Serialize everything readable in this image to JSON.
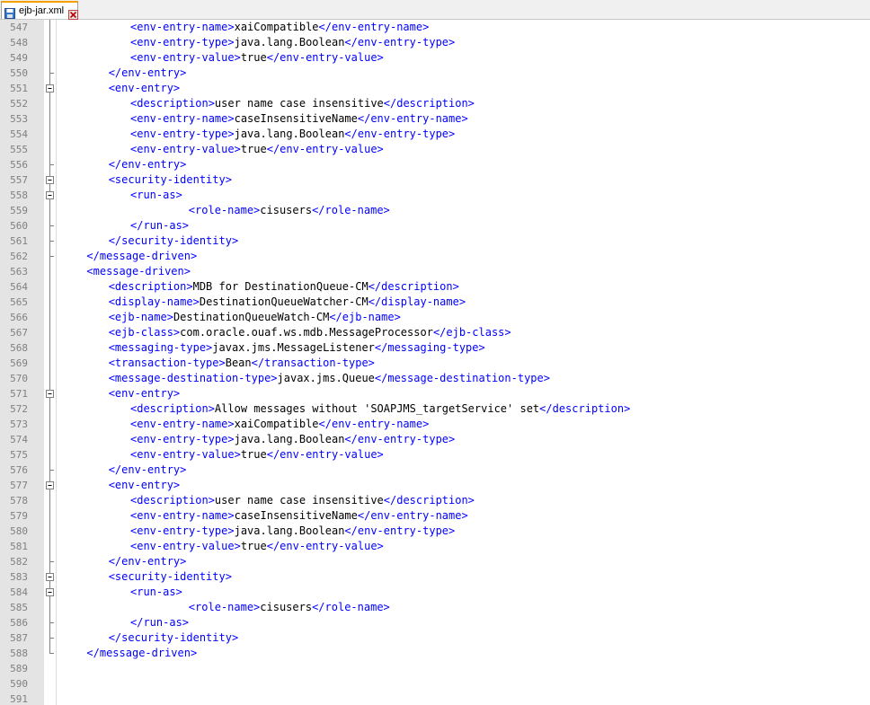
{
  "tab": {
    "label": "ejb-jar.xml",
    "icon": "save-icon",
    "close_icon": "close-icon"
  },
  "colors": {
    "tag": "#0000ff",
    "text": "#000000",
    "line_number": "#808080",
    "gutter": "#e4e4e4"
  },
  "lines": [
    {
      "n": "547",
      "parts": [
        {
          "t": "<env-entry-name>",
          "k": "tag"
        },
        {
          "t": "xaiCompatible",
          "k": "txt"
        },
        {
          "t": "</env-entry-name>",
          "k": "tag"
        }
      ]
    },
    {
      "n": "548",
      "parts": [
        {
          "t": "<env-entry-type>",
          "k": "tag"
        },
        {
          "t": "java.lang.Boolean",
          "k": "txt"
        },
        {
          "t": "</env-entry-type>",
          "k": "tag"
        }
      ]
    },
    {
      "n": "549",
      "parts": [
        {
          "t": "<env-entry-value>",
          "k": "tag"
        },
        {
          "t": "true",
          "k": "txt"
        },
        {
          "t": "</env-entry-value>",
          "k": "tag"
        }
      ]
    },
    {
      "n": "550",
      "parts": [
        {
          "t": "</env-entry>",
          "k": "tag"
        }
      ]
    },
    {
      "n": "551",
      "parts": [
        {
          "t": "<env-entry>",
          "k": "tag"
        }
      ]
    },
    {
      "n": "552",
      "parts": [
        {
          "t": "<description>",
          "k": "tag"
        },
        {
          "t": "user name case insensitive",
          "k": "txt"
        },
        {
          "t": "</description>",
          "k": "tag"
        }
      ]
    },
    {
      "n": "553",
      "parts": [
        {
          "t": "<env-entry-name>",
          "k": "tag"
        },
        {
          "t": "caseInsensitiveName",
          "k": "txt"
        },
        {
          "t": "</env-entry-name>",
          "k": "tag"
        }
      ]
    },
    {
      "n": "554",
      "parts": [
        {
          "t": "<env-entry-type>",
          "k": "tag"
        },
        {
          "t": "java.lang.Boolean",
          "k": "txt"
        },
        {
          "t": "</env-entry-type>",
          "k": "tag"
        }
      ]
    },
    {
      "n": "555",
      "parts": [
        {
          "t": "<env-entry-value>",
          "k": "tag"
        },
        {
          "t": "true",
          "k": "txt"
        },
        {
          "t": "</env-entry-value>",
          "k": "tag"
        }
      ]
    },
    {
      "n": "556",
      "parts": [
        {
          "t": "</env-entry>",
          "k": "tag"
        }
      ]
    },
    {
      "n": "557",
      "parts": [
        {
          "t": "<security-identity>",
          "k": "tag"
        }
      ]
    },
    {
      "n": "558",
      "parts": [
        {
          "t": "<run-as>",
          "k": "tag"
        }
      ]
    },
    {
      "n": "559",
      "parts": [
        {
          "t": "<role-name>",
          "k": "tag"
        },
        {
          "t": "cisusers",
          "k": "txt"
        },
        {
          "t": "</role-name>",
          "k": "tag"
        }
      ]
    },
    {
      "n": "560",
      "parts": [
        {
          "t": "</run-as>",
          "k": "tag"
        }
      ]
    },
    {
      "n": "561",
      "parts": [
        {
          "t": "</security-identity>",
          "k": "tag"
        }
      ]
    },
    {
      "n": "562",
      "parts": [
        {
          "t": "</message-driven>",
          "k": "tag"
        }
      ]
    },
    {
      "n": "563",
      "parts": [
        {
          "t": "<message-driven>",
          "k": "tag"
        }
      ]
    },
    {
      "n": "564",
      "parts": [
        {
          "t": "<description>",
          "k": "tag"
        },
        {
          "t": "MDB for DestinationQueue-CM",
          "k": "txt"
        },
        {
          "t": "</description>",
          "k": "tag"
        }
      ]
    },
    {
      "n": "565",
      "parts": [
        {
          "t": "<display-name>",
          "k": "tag"
        },
        {
          "t": "DestinationQueueWatcher-CM",
          "k": "txt"
        },
        {
          "t": "</display-name>",
          "k": "tag"
        }
      ]
    },
    {
      "n": "566",
      "parts": [
        {
          "t": "<ejb-name>",
          "k": "tag"
        },
        {
          "t": "DestinationQueueWatch-CM",
          "k": "txt"
        },
        {
          "t": "</ejb-name>",
          "k": "tag"
        }
      ]
    },
    {
      "n": "567",
      "parts": [
        {
          "t": "<ejb-class>",
          "k": "tag"
        },
        {
          "t": "com.oracle.ouaf.ws.mdb.MessageProcessor",
          "k": "txt"
        },
        {
          "t": "</ejb-class>",
          "k": "tag"
        }
      ]
    },
    {
      "n": "568",
      "parts": [
        {
          "t": "<messaging-type>",
          "k": "tag"
        },
        {
          "t": "javax.jms.MessageListener",
          "k": "txt"
        },
        {
          "t": "</messaging-type>",
          "k": "tag"
        }
      ]
    },
    {
      "n": "569",
      "parts": [
        {
          "t": "<transaction-type>",
          "k": "tag"
        },
        {
          "t": "Bean",
          "k": "txt"
        },
        {
          "t": "</transaction-type>",
          "k": "tag"
        }
      ]
    },
    {
      "n": "570",
      "parts": [
        {
          "t": "<message-destination-type>",
          "k": "tag"
        },
        {
          "t": "javax.jms.Queue",
          "k": "txt"
        },
        {
          "t": "</message-destination-type>",
          "k": "tag"
        }
      ]
    },
    {
      "n": "571",
      "parts": [
        {
          "t": "<env-entry>",
          "k": "tag"
        }
      ]
    },
    {
      "n": "572",
      "parts": [
        {
          "t": "<description>",
          "k": "tag"
        },
        {
          "t": "Allow messages without 'SOAPJMS_targetService' set",
          "k": "txt"
        },
        {
          "t": "</description>",
          "k": "tag"
        }
      ]
    },
    {
      "n": "573",
      "parts": [
        {
          "t": "<env-entry-name>",
          "k": "tag"
        },
        {
          "t": "xaiCompatible",
          "k": "txt"
        },
        {
          "t": "</env-entry-name>",
          "k": "tag"
        }
      ]
    },
    {
      "n": "574",
      "parts": [
        {
          "t": "<env-entry-type>",
          "k": "tag"
        },
        {
          "t": "java.lang.Boolean",
          "k": "txt"
        },
        {
          "t": "</env-entry-type>",
          "k": "tag"
        }
      ]
    },
    {
      "n": "575",
      "parts": [
        {
          "t": "<env-entry-value>",
          "k": "tag"
        },
        {
          "t": "true",
          "k": "txt"
        },
        {
          "t": "</env-entry-value>",
          "k": "tag"
        }
      ]
    },
    {
      "n": "576",
      "parts": [
        {
          "t": "</env-entry>",
          "k": "tag"
        }
      ]
    },
    {
      "n": "577",
      "parts": [
        {
          "t": "<env-entry>",
          "k": "tag"
        }
      ]
    },
    {
      "n": "578",
      "parts": [
        {
          "t": "<description>",
          "k": "tag"
        },
        {
          "t": "user name case insensitive",
          "k": "txt"
        },
        {
          "t": "</description>",
          "k": "tag"
        }
      ]
    },
    {
      "n": "579",
      "parts": [
        {
          "t": "<env-entry-name>",
          "k": "tag"
        },
        {
          "t": "caseInsensitiveName",
          "k": "txt"
        },
        {
          "t": "</env-entry-name>",
          "k": "tag"
        }
      ]
    },
    {
      "n": "580",
      "parts": [
        {
          "t": "<env-entry-type>",
          "k": "tag"
        },
        {
          "t": "java.lang.Boolean",
          "k": "txt"
        },
        {
          "t": "</env-entry-type>",
          "k": "tag"
        }
      ]
    },
    {
      "n": "581",
      "parts": [
        {
          "t": "<env-entry-value>",
          "k": "tag"
        },
        {
          "t": "true",
          "k": "txt"
        },
        {
          "t": "</env-entry-value>",
          "k": "tag"
        }
      ]
    },
    {
      "n": "582",
      "parts": [
        {
          "t": "</env-entry>",
          "k": "tag"
        }
      ]
    },
    {
      "n": "583",
      "parts": [
        {
          "t": "<security-identity>",
          "k": "tag"
        }
      ]
    },
    {
      "n": "584",
      "parts": [
        {
          "t": "<run-as>",
          "k": "tag"
        }
      ]
    },
    {
      "n": "585",
      "parts": [
        {
          "t": "<role-name>",
          "k": "tag"
        },
        {
          "t": "cisusers",
          "k": "txt"
        },
        {
          "t": "</role-name>",
          "k": "tag"
        }
      ]
    },
    {
      "n": "586",
      "parts": [
        {
          "t": "</run-as>",
          "k": "tag"
        }
      ]
    },
    {
      "n": "587",
      "parts": [
        {
          "t": "</security-identity>",
          "k": "tag"
        }
      ]
    },
    {
      "n": "588",
      "parts": [
        {
          "t": "</message-driven>",
          "k": "tag"
        }
      ]
    },
    {
      "n": "589",
      "parts": []
    },
    {
      "n": "590",
      "parts": []
    },
    {
      "n": "591",
      "parts": []
    }
  ]
}
